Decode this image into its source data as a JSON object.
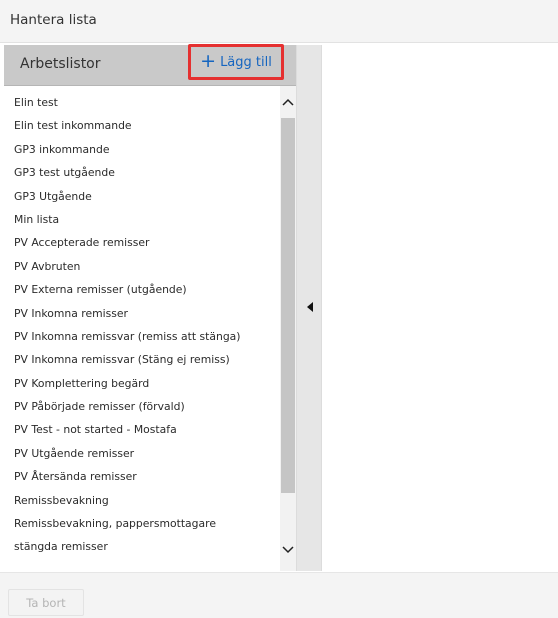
{
  "header": {
    "title": "Hantera lista"
  },
  "panel": {
    "heading": "Arbetslistor",
    "add_button": {
      "icon": "plus-icon",
      "label": "Lägg till"
    }
  },
  "worklists": [
    "Elin test",
    "Elin test inkommande",
    "GP3 inkommande",
    "GP3 test utgående",
    "GP3 Utgående",
    "Min lista",
    "PV Accepterade remisser",
    "PV Avbruten",
    "PV Externa remisser (utgående)",
    "PV Inkomna remisser",
    "PV Inkomna remissvar (remiss att stänga)",
    "PV Inkomna remissvar (Stäng ej remiss)",
    "PV Komplettering begärd",
    "PV Påbörjade remisser   (förvald)",
    "PV Test - not started - Mostafa",
    "PV Utgående remisser",
    "PV Återsända remisser",
    "Remissbevakning",
    "Remissbevakning, pappersmottagare",
    "stängda remisser"
  ],
  "footer": {
    "delete_button": "Ta bort"
  },
  "colors": {
    "accent": "#1565c0",
    "highlight_border": "#e53030",
    "panel_header": "#c9c9c9"
  }
}
